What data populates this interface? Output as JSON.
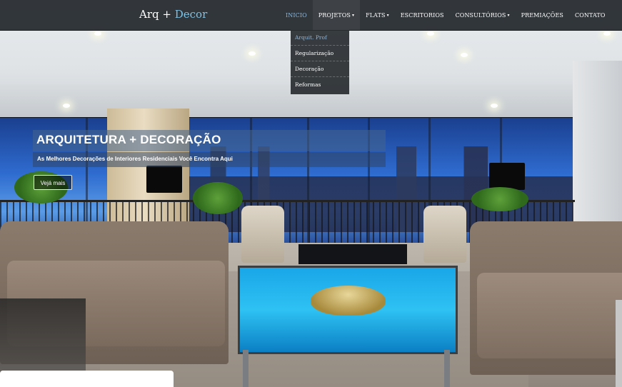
{
  "navbar": {
    "brand_part1": "Arq +",
    "brand_part2": "Decor",
    "items": [
      {
        "label": "INICIO",
        "active": true,
        "has_caret": false
      },
      {
        "label": "PROJETOS",
        "active": false,
        "has_caret": true
      },
      {
        "label": "FLATS",
        "active": false,
        "has_caret": true
      },
      {
        "label": "ESCRITORIOS",
        "active": false,
        "has_caret": false
      },
      {
        "label": "CONSULTÓRIOS",
        "active": false,
        "has_caret": true
      },
      {
        "label": "PREMIAÇÕES",
        "active": false,
        "has_caret": false
      },
      {
        "label": "CONTATO",
        "active": false,
        "has_caret": false
      }
    ],
    "caret_glyph": "▾"
  },
  "dropdown": {
    "items": [
      "Arquit. Prof",
      "Regularização",
      "Decoração",
      "Reformas"
    ]
  },
  "hero": {
    "title": "ARQUITETURA + DECORAÇÃO",
    "subtitle": "As Melhores Decorações de Interiores Residenciais Você Encontra Aqui",
    "button_label": "Vejá mais"
  },
  "colors": {
    "navbar_bg": "#22262a",
    "brand_accent": "#7ec3e6",
    "active_link": "#8fb6d8"
  }
}
